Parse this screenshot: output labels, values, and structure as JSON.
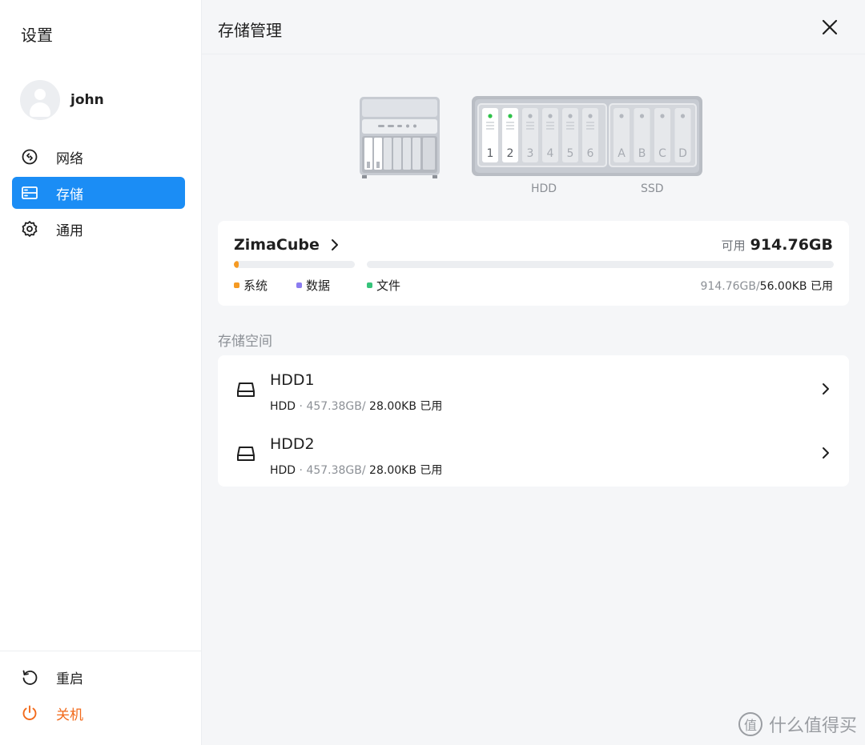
{
  "sidebar": {
    "title": "设置",
    "user": {
      "name": "john"
    },
    "items": [
      {
        "label": "网络",
        "icon": "network-icon",
        "active": false
      },
      {
        "label": "存储",
        "icon": "storage-icon",
        "active": true
      },
      {
        "label": "通用",
        "icon": "gear-icon",
        "active": false
      }
    ],
    "bottom_items": [
      {
        "label": "重启",
        "icon": "restart-icon"
      },
      {
        "label": "关机",
        "icon": "power-icon",
        "color": "#f26a1b"
      }
    ]
  },
  "header": {
    "title": "存储管理",
    "close_icon": "close-icon"
  },
  "devices": {
    "rack_slots": [
      "1",
      "2",
      "3",
      "4",
      "5",
      "6",
      "A",
      "B",
      "C",
      "D"
    ],
    "hdd_caption": "HDD",
    "ssd_caption": "SSD",
    "active_slots": [
      "1",
      "2"
    ]
  },
  "summary": {
    "device_name": "ZimaCube",
    "available_label": "可用",
    "available_value": "914.76GB",
    "legend": [
      {
        "label": "系统",
        "color": "#f59a23"
      },
      {
        "label": "数据",
        "color": "#8b7cf0"
      },
      {
        "label": "文件",
        "color": "#36c37a"
      }
    ],
    "usage_total": "914.76GB/",
    "usage_used": "56.00KB 已用",
    "system_bar_fraction": 0.04
  },
  "section_title": "存储空间",
  "disks": [
    {
      "name": "HDD1",
      "type": "HDD",
      "capacity": " · 457.38GB/",
      "used": " 28.00KB 已用"
    },
    {
      "name": "HDD2",
      "type": "HDD",
      "capacity": " · 457.38GB/",
      "used": " 28.00KB 已用"
    }
  ],
  "colors": {
    "accent": "#1b8df5",
    "danger": "#f26a1b"
  },
  "watermark": {
    "badge": "值",
    "text": "什么值得买"
  }
}
